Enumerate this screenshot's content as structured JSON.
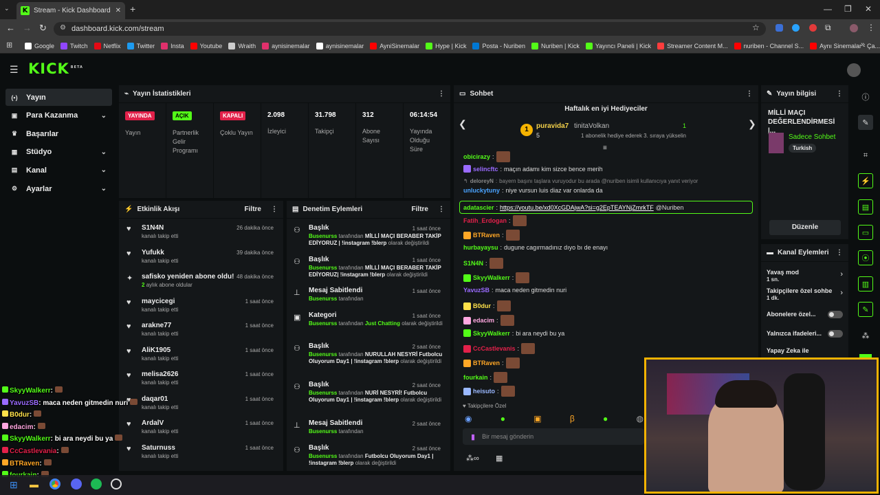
{
  "browser": {
    "tab_title": "Stream - Kick Dashboard",
    "url": "dashboard.kick.com/stream",
    "bookmarks": [
      {
        "label": "Google",
        "color": "#ffffff"
      },
      {
        "label": "Twitch",
        "color": "#9146ff"
      },
      {
        "label": "Netflix",
        "color": "#e50914"
      },
      {
        "label": "Twitter",
        "color": "#1d9bf0"
      },
      {
        "label": "Insta",
        "color": "#e1306c"
      },
      {
        "label": "Youtube",
        "color": "#ff0000"
      },
      {
        "label": "Wraith",
        "color": "#cccccc"
      },
      {
        "label": "aynisinemalar",
        "color": "#e1306c"
      },
      {
        "label": "aynisinemalar",
        "color": "#ffffff"
      },
      {
        "label": "AyniSinemalar",
        "color": "#ff0000"
      },
      {
        "label": "Hype | Kick",
        "color": "#53fc18"
      },
      {
        "label": "Posta - Nuriben",
        "color": "#0078d4"
      },
      {
        "label": "Nuriben | Kick",
        "color": "#53fc18"
      },
      {
        "label": "Yayıncı Paneli | Kick",
        "color": "#53fc18"
      },
      {
        "label": "Streamer Content M...",
        "color": "#ff3d3d"
      },
      {
        "label": "nuriben - Channel S...",
        "color": "#ff0000"
      },
      {
        "label": "Aynı Sinemalar - Ça...",
        "color": "#ff0000"
      }
    ]
  },
  "header": {
    "logo": "KICK",
    "beta": "BETA"
  },
  "sidebar": {
    "items": [
      {
        "label": "Yayın",
        "icon": "broadcast-icon"
      },
      {
        "label": "Para Kazanma",
        "icon": "money-icon"
      },
      {
        "label": "Başarılar",
        "icon": "trophy-icon"
      },
      {
        "label": "Stüdyo",
        "icon": "studio-icon"
      },
      {
        "label": "Kanal",
        "icon": "channel-icon"
      },
      {
        "label": "Ayarlar",
        "icon": "gear-icon"
      }
    ]
  },
  "stats": {
    "title": "Yayın İstatistikleri",
    "columns": [
      {
        "badge": "YAYINDA",
        "badge_color": "#e2214a",
        "label": "Yayın"
      },
      {
        "badge": "AÇIK",
        "badge_color": "#53fc18",
        "label": "Partnerlik Gelir Programı"
      },
      {
        "badge": "KAPALI",
        "badge_color": "#e2214a",
        "label": "Çoklu Yayın"
      },
      {
        "value": "2.098",
        "label": "İzleyici"
      },
      {
        "value": "31.798",
        "label": "Takipçi"
      },
      {
        "value": "312",
        "label": "Abone Sayısı"
      },
      {
        "value": "06:14:54",
        "label": "Yayında Olduğu Süre"
      }
    ]
  },
  "activity": {
    "title": "Etkinlik Akışı",
    "filter": "Filtre",
    "items": [
      {
        "name": "S1N4N",
        "sub": "kanalı takip etti",
        "time": "26 dakika önce"
      },
      {
        "name": "Yufukk",
        "sub": "kanalı takip etti",
        "time": "39 dakika önce"
      },
      {
        "name": "safisko yeniden abone oldu!",
        "sub_green": "2",
        "sub": "aylık abone oldular",
        "time": "48 dakika önce"
      },
      {
        "name": "maycicegi",
        "sub": "kanalı takip etti",
        "time": "1 saat önce"
      },
      {
        "name": "arakne77",
        "sub": "kanalı takip etti",
        "time": "1 saat önce"
      },
      {
        "name": "AliK1905",
        "sub": "kanalı takip etti",
        "time": "1 saat önce"
      },
      {
        "name": "melisa2626",
        "sub": "kanalı takip etti",
        "time": "1 saat önce"
      },
      {
        "name": "daqar01",
        "sub": "kanalı takip etti",
        "time": "1 saat önce"
      },
      {
        "name": "ArdalV",
        "sub": "kanalı takip etti",
        "time": "1 saat önce"
      },
      {
        "name": "Saturnuss",
        "sub": "kanalı takip etti",
        "time": "1 saat önce"
      }
    ]
  },
  "moderation": {
    "title": "Denetim Eylemleri",
    "filter": "Filtre",
    "items": [
      {
        "name": "Başlık",
        "time": "1 saat önce",
        "user": "Busenurss",
        "mid": "tarafından",
        "value": "MİLLİ MAÇI BERABER TAKİP EDİYORUZ | !instagram !blerp",
        "tail": "olarak değiştirildi"
      },
      {
        "name": "Başlık",
        "time": "1 saat önce",
        "user": "Busenurss",
        "mid": "tarafından",
        "value": "MİLLİ MAÇI BERABER TAKİP EDİYORUZ| !instagram !blerp",
        "tail": "olarak değiştirildi"
      },
      {
        "name": "Mesaj Sabitlendi",
        "time": "1 saat önce",
        "user": "Busenurss",
        "mid": "tarafından",
        "value": "",
        "tail": ""
      },
      {
        "name": "Kategori",
        "time": "1 saat önce",
        "user": "Busenurss",
        "mid": "tarafından",
        "value": "Just Chatting",
        "tail": "olarak değiştirildi"
      },
      {
        "name": "Başlık",
        "time": "2 saat önce",
        "user": "Busenurss",
        "mid": "tarafından",
        "value": "NURULLAH NESYRİ Futbolcu Oluyorum Day1 | !instagram !blerp",
        "tail": "olarak değiştirildi"
      },
      {
        "name": "Başlık",
        "time": "2 saat önce",
        "user": "Busenurss",
        "mid": "tarafından",
        "value": "NURİ NESYRİ! Futbolcu Oluyorum Day1 | !instagram !blerp",
        "tail": "olarak değiştirildi"
      },
      {
        "name": "Mesaj Sabitlendi",
        "time": "2 saat önce",
        "user": "Busenurss",
        "mid": "tarafından",
        "value": "",
        "tail": ""
      },
      {
        "name": "Başlık",
        "time": "2 saat önce",
        "user": "Busenurss",
        "mid": "tarafından",
        "value": "Futbolcu Oluyorum Day1 | !instagram !blerp",
        "tail": "olarak değiştirildi"
      }
    ]
  },
  "chat": {
    "title": "Sohbet",
    "gifters_title": "Haftalık en iyi Hediyeciler",
    "top_gifter": {
      "rank": "1",
      "name": "puravida7",
      "count": "5"
    },
    "runner_up": {
      "name": "tinitaVolkan",
      "count": "1",
      "note": "1 abonelik hediye ederek 3. sıraya yükselin"
    },
    "messages": [
      {
        "user": "obicirazy",
        "color": "#53fc18",
        "text": "",
        "emote": true
      },
      {
        "user": "selincftc",
        "color": "#9a6bff",
        "text": "maçın adamı kim sizce bence merih"
      },
      {
        "user": "deloreyN",
        "color": "#8a8a8a",
        "text": "bayern başını taşlara vuruyodur bu arada @nuriben isimli kullanıcıya yanıt veriyor",
        "reply": true
      },
      {
        "user": "unluckytuny",
        "color": "#4aa3ff",
        "text": "niye vursun luis diaz var onlarda da"
      },
      {
        "user": "adatascier",
        "color": "#53fc18",
        "link": "https://youtu.be/xd0XcGDAjwA?si=g2EpTEAYNjZmrkTF",
        "text": "@Nuriben",
        "highlight": true
      },
      {
        "user": "Fatih_Erdogan",
        "color": "#e2214a",
        "text": "",
        "emote": true
      },
      {
        "user": "BTRaven",
        "color": "#ffa726",
        "text": "",
        "emote": true
      },
      {
        "user": "hurbayaysu",
        "color": "#53fc18",
        "text": "dugune cagırmadınız dıyo bı de enayı"
      },
      {
        "user": "S1N4N",
        "color": "#53fc18",
        "text": "",
        "emote": true
      },
      {
        "user": "SkyyWalkerr",
        "color": "#53fc18",
        "text": "",
        "emote": true
      },
      {
        "user": "YavuzSB",
        "color": "#9a6bff",
        "text": "maca neden gitmedin nuri"
      },
      {
        "user": "B0dur",
        "color": "#ffe14a",
        "text": "",
        "emote": true
      },
      {
        "user": "edacim",
        "color": "#ffa7e0",
        "text": "",
        "emote": true
      },
      {
        "user": "SkyyWalkerr",
        "color": "#53fc18",
        "text": "bi ara neydi bu ya"
      },
      {
        "user": "CcCastlevanis",
        "color": "#e2214a",
        "text": "",
        "emote": true
      },
      {
        "user": "BTRaven",
        "color": "#ffa726",
        "text": "",
        "emote": true
      },
      {
        "user": "fourkain",
        "color": "#53fc18",
        "text": "",
        "emote": true
      },
      {
        "user": "heisuto",
        "color": "#9ab8ff",
        "text": "",
        "emote": true
      }
    ],
    "followers_only": "Takipçilere Özel",
    "input_placeholder": "Bir mesaj gönderin"
  },
  "stream_info": {
    "title": "Yayın bilgisi",
    "stream_title": "MİLLİ MAÇI DEĞERLENDİRMESİ |...",
    "category": "Sadece Sohbet",
    "language": "Turkish",
    "edit": "Düzenle"
  },
  "channel_actions": {
    "title": "Kanal Eylemleri",
    "items": [
      {
        "label": "Yavaş mod",
        "value": "1 sn.",
        "type": "chevron"
      },
      {
        "label": "Takipçilere özel sohbe",
        "value": "1 dk.",
        "type": "chevron"
      },
      {
        "label": "Abonelere özel...",
        "type": "toggle"
      },
      {
        "label": "Yalnızca ifadeleri...",
        "type": "toggle"
      },
      {
        "label": "Yapay Zeka ile",
        "type": "text"
      }
    ]
  },
  "overlay_chat": [
    {
      "user": "SkyyWalkerr",
      "color": "#53fc18",
      "text": ":"
    },
    {
      "user": "YavuzSB",
      "color": "#9a6bff",
      "text": ": maca neden gitmedin nuri"
    },
    {
      "user": "B0dur",
      "color": "#ffe14a",
      "text": ":"
    },
    {
      "user": "edacim",
      "color": "#ffa7e0",
      "text": ":"
    },
    {
      "user": "SkyyWalkerr",
      "color": "#53fc18",
      "text": ": bi ara neydi bu ya"
    },
    {
      "user": "CcCastlevania",
      "color": "#e2214a",
      "text": ":"
    },
    {
      "user": "BTRaven",
      "color": "#ffa726",
      "text": ":"
    },
    {
      "user": "fourkain",
      "color": "#53fc18",
      "text": ":"
    }
  ],
  "colors": {
    "accent": "#53fc18",
    "live": "#e2214a",
    "panel": "#141719",
    "bg": "#0b0e0f"
  }
}
